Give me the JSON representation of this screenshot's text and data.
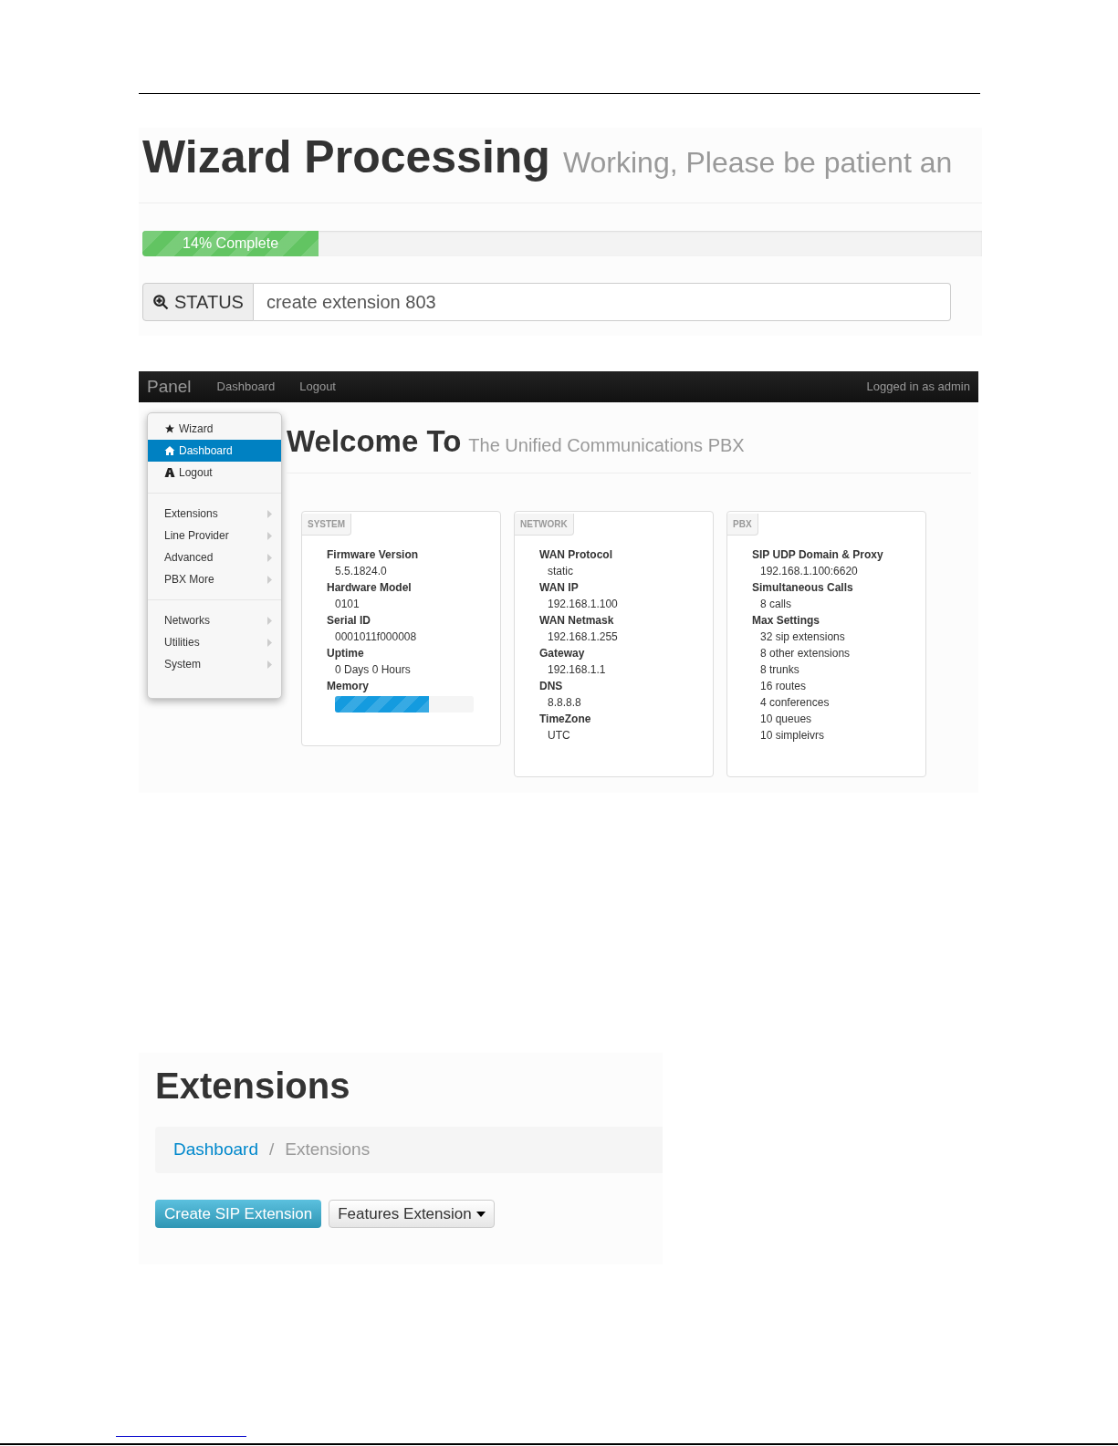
{
  "wizard": {
    "title": "Wizard Processing",
    "subtitle": "Working, Please be patient an",
    "progress": {
      "label": "14% Complete",
      "level": 0.21
    },
    "status": {
      "label": "STATUS",
      "value": "create extension 803"
    }
  },
  "panel": {
    "navbar": {
      "brand": "Panel",
      "links": [
        "Dashboard",
        "Logout"
      ],
      "user": "Logged in as admin"
    },
    "sidebar": {
      "groups": [
        [
          {
            "label": "Wizard",
            "kind": "star",
            "selected": false
          },
          {
            "label": "Dashboard",
            "kind": "home",
            "selected": true
          },
          {
            "label": "Logout",
            "kind": "road",
            "selected": false
          }
        ],
        [
          {
            "label": "Extensions",
            "kind": "submenu",
            "selected": false
          },
          {
            "label": "Line Provider",
            "kind": "submenu",
            "selected": false
          },
          {
            "label": "Advanced",
            "kind": "submenu",
            "selected": false
          },
          {
            "label": "PBX More",
            "kind": "submenu",
            "selected": false
          }
        ],
        [
          {
            "label": "Networks",
            "kind": "submenu",
            "selected": false
          },
          {
            "label": "Utilities",
            "kind": "submenu",
            "selected": false
          },
          {
            "label": "System",
            "kind": "submenu",
            "selected": false
          }
        ]
      ]
    },
    "heading": "Welcome To",
    "subheading": "The Unified Communications PBX",
    "cards": [
      {
        "title": "SYSTEM",
        "fields": [
          {
            "label": "Firmware Version",
            "kind": "text",
            "values": [
              "5.5.1824.0"
            ]
          },
          {
            "label": "Hardware Model",
            "kind": "text",
            "values": [
              "0101"
            ]
          },
          {
            "label": "Serial ID",
            "kind": "text",
            "values": [
              "0001011f000008"
            ]
          },
          {
            "label": "Uptime",
            "kind": "text",
            "values": [
              "0 Days 0 Hours"
            ]
          },
          {
            "label": "Memory",
            "kind": "meter",
            "level": 0.68
          }
        ]
      },
      {
        "title": "NETWORK",
        "fields": [
          {
            "label": "WAN Protocol",
            "kind": "text",
            "values": [
              "static"
            ]
          },
          {
            "label": "WAN IP",
            "kind": "text",
            "values": [
              "192.168.1.100"
            ]
          },
          {
            "label": "WAN Netmask",
            "kind": "text",
            "values": [
              "192.168.1.255"
            ]
          },
          {
            "label": "Gateway",
            "kind": "text",
            "values": [
              "192.168.1.1"
            ]
          },
          {
            "label": "DNS",
            "kind": "text",
            "values": [
              "8.8.8.8"
            ]
          },
          {
            "label": "TimeZone",
            "kind": "text",
            "values": [
              "UTC"
            ]
          }
        ]
      },
      {
        "title": "PBX",
        "fields": [
          {
            "label": "SIP UDP Domain & Proxy",
            "kind": "text",
            "values": [
              "192.168.1.100:6620"
            ]
          },
          {
            "label": "Simultaneous Calls",
            "kind": "text",
            "values": [
              "8 calls"
            ]
          },
          {
            "label": "Max Settings",
            "kind": "text",
            "values": [
              "32 sip extensions",
              "8 other extensions",
              "8 trunks",
              "16 routes",
              "4 conferences",
              "10 queues",
              "10 simpleivrs"
            ]
          }
        ]
      }
    ]
  },
  "extensions": {
    "title": "Extensions",
    "breadcrumb": {
      "items": [
        "Dashboard",
        "Extensions"
      ],
      "separator": "/"
    },
    "buttons": [
      {
        "label": "Create SIP Extension",
        "kind": "primary"
      },
      {
        "label": "Features Extension",
        "kind": "dropdown"
      }
    ]
  }
}
